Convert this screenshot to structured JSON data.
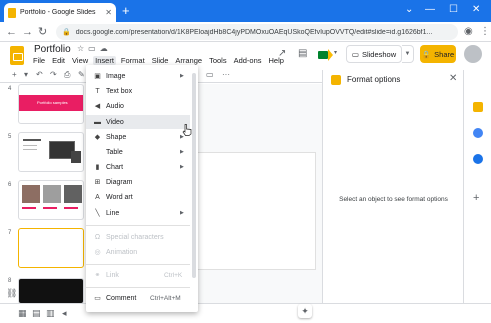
{
  "browser": {
    "tab_title": "Portfolio - Google Slides",
    "url": "docs.google.com/presentation/d/1K8PEloajdHb8C4jyPDMOxuOAEqUSkoQEfvIupOVVTQ/edit#slide=id.g1626bf1..."
  },
  "app": {
    "doc_title": "Portfolio",
    "menus": [
      "File",
      "Edit",
      "View",
      "Insert",
      "Format",
      "Slide",
      "Arrange",
      "Tools",
      "Add-ons",
      "Help"
    ],
    "slideshow_label": "Slideshow",
    "share_label": "Share"
  },
  "filmstrip": {
    "slide_numbers": [
      "4",
      "5",
      "6",
      "7",
      "8"
    ],
    "slide4_text": "Portfolio samples",
    "selected_slide": "7"
  },
  "insert_menu": {
    "items": [
      {
        "icon": "image-icon",
        "label": "Image",
        "submenu": true,
        "enabled": true
      },
      {
        "icon": "text-box-icon",
        "label": "Text box",
        "enabled": true
      },
      {
        "icon": "audio-icon",
        "label": "Audio",
        "enabled": true
      },
      {
        "icon": "video-icon",
        "label": "Video",
        "enabled": true,
        "hover": true
      },
      {
        "icon": "shape-icon",
        "label": "Shape",
        "submenu": true,
        "enabled": true
      },
      {
        "icon": "",
        "label": "Table",
        "submenu": true,
        "enabled": true
      },
      {
        "icon": "chart-icon",
        "label": "Chart",
        "submenu": true,
        "enabled": true
      },
      {
        "icon": "diagram-icon",
        "label": "Diagram",
        "enabled": true
      },
      {
        "icon": "word-art-icon",
        "label": "Word art",
        "enabled": true
      },
      {
        "icon": "line-icon",
        "label": "Line",
        "submenu": true,
        "enabled": true
      },
      {
        "icon": "omega-icon",
        "label": "Special characters",
        "enabled": false
      },
      {
        "icon": "animation-icon",
        "label": "Animation",
        "enabled": false
      },
      {
        "icon": "link-icon",
        "label": "Link",
        "shortcut": "Ctrl+K",
        "enabled": false
      },
      {
        "icon": "comment-icon",
        "label": "Comment",
        "shortcut": "Ctrl+Alt+M",
        "enabled": true
      }
    ]
  },
  "format_options": {
    "title": "Format options",
    "hint": "Select an object to see format options"
  },
  "colors": {
    "chrome_blue": "#1a73e8",
    "slides_yellow": "#f4b400",
    "menu_hover": "#e8eaed"
  }
}
